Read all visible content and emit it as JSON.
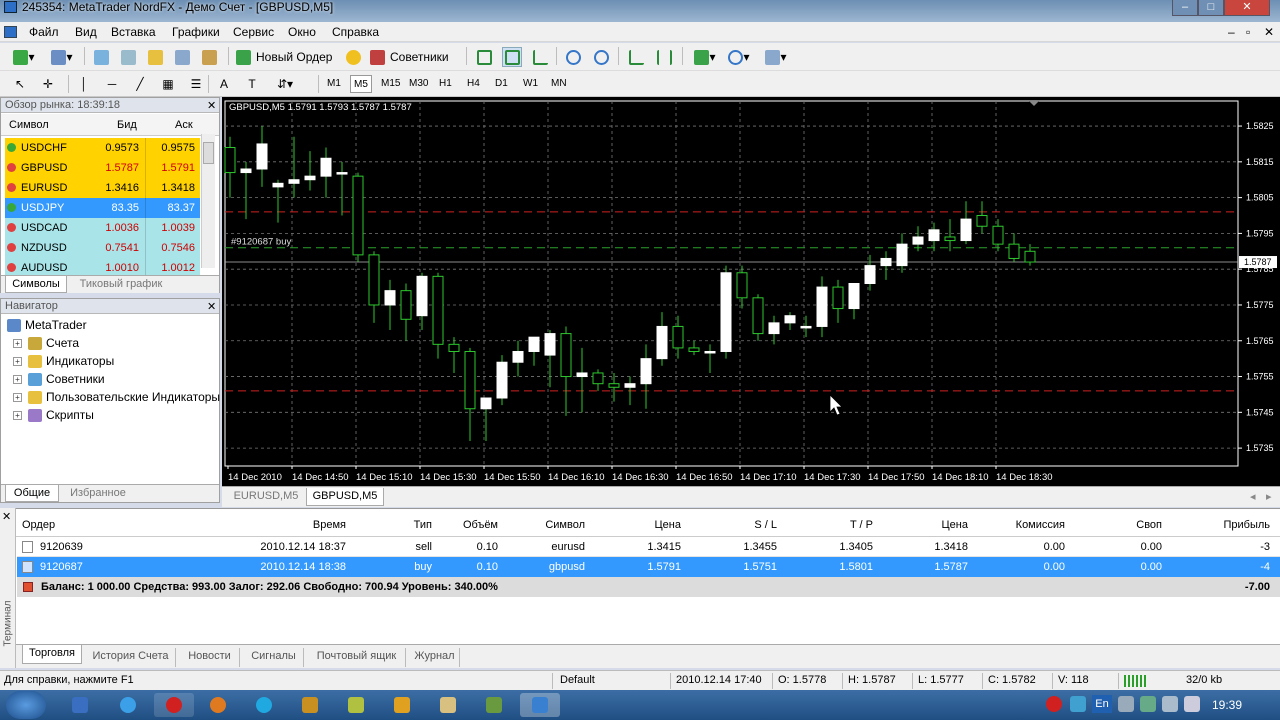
{
  "window": {
    "title": "245354: MetaTrader NordFX - Демо Счет - [GBPUSD,M5]"
  },
  "menu": [
    "Файл",
    "Вид",
    "Вставка",
    "Графики",
    "Сервис",
    "Окно",
    "Справка"
  ],
  "toolbar": {
    "new_order": "Новый Ордер",
    "experts": "Советники"
  },
  "timeframes": [
    "M1",
    "M5",
    "M15",
    "M30",
    "H1",
    "H4",
    "D1",
    "W1",
    "MN"
  ],
  "active_timeframe": "M5",
  "market_watch": {
    "title": "Обзор рынка: 18:39:18",
    "columns": {
      "symbol": "Символ",
      "bid": "Бид",
      "ask": "Аск"
    },
    "rows": [
      {
        "symbol": "USDCHF",
        "bid": "0.9573",
        "ask": "0.9575",
        "color": "#ffd200",
        "price_color": "#000000",
        "dir": "up"
      },
      {
        "symbol": "GBPUSD",
        "bid": "1.5787",
        "ask": "1.5791",
        "color": "#ffd200",
        "price_color": "#d00000",
        "dir": "down"
      },
      {
        "symbol": "EURUSD",
        "bid": "1.3416",
        "ask": "1.3418",
        "color": "#ffd200",
        "price_color": "#000000",
        "dir": "down"
      },
      {
        "symbol": "USDJPY",
        "bid": "83.35",
        "ask": "83.37",
        "color": "#3399ff",
        "price_color": "#ffffff",
        "dir": "up"
      },
      {
        "symbol": "USDCAD",
        "bid": "1.0036",
        "ask": "1.0039",
        "color": "#a8e4e8",
        "price_color": "#d00000",
        "dir": "down"
      },
      {
        "symbol": "NZDUSD",
        "bid": "0.7541",
        "ask": "0.7546",
        "color": "#a8e4e8",
        "price_color": "#d00000",
        "dir": "down"
      },
      {
        "symbol": "AUDUSD",
        "bid": "1.0010",
        "ask": "1.0012",
        "color": "#a8e4e8",
        "price_color": "#d00000",
        "dir": "down"
      }
    ],
    "tabs": [
      "Символы",
      "Тиковый график"
    ]
  },
  "navigator": {
    "title": "Навигатор",
    "root": "MetaTrader",
    "items": [
      "Счета",
      "Индикаторы",
      "Советники",
      "Пользовательские Индикаторы",
      "Скрипты"
    ],
    "tabs": [
      "Общие",
      "Избранное"
    ]
  },
  "chart": {
    "legend": "GBPUSD,M5  1.5791 1.5793 1.5787 1.5787",
    "order_label": "#9120687 buy",
    "current_price": "1.5787",
    "price_labels": [
      "1.5825",
      "1.5815",
      "1.5805",
      "1.5795",
      "1.5785",
      "1.5775",
      "1.5765",
      "1.5755",
      "1.5745",
      "1.5735"
    ],
    "time_labels": [
      "14 Dec 2010",
      "14 Dec 14:50",
      "14 Dec 15:10",
      "14 Dec 15:30",
      "14 Dec 15:50",
      "14 Dec 16:10",
      "14 Dec 16:30",
      "14 Dec 16:50",
      "14 Dec 17:10",
      "14 Dec 17:30",
      "14 Dec 17:50",
      "14 Dec 18:10",
      "14 Dec 18:30"
    ],
    "tabs": [
      "EURUSD,M5",
      "GBPUSD,M5"
    ],
    "lines": {
      "tp": 1.5801,
      "sl": 1.5751,
      "entry": 1.5791,
      "bid": 1.5787
    },
    "candles": [
      [
        1.5819,
        1.5822,
        1.5805,
        1.5812
      ],
      [
        1.5812,
        1.5815,
        1.5799,
        1.5813
      ],
      [
        1.5813,
        1.5825,
        1.5808,
        1.582
      ],
      [
        1.5808,
        1.581,
        1.5798,
        1.5809
      ],
      [
        1.5809,
        1.5822,
        1.5805,
        1.581
      ],
      [
        1.581,
        1.5818,
        1.5807,
        1.5811
      ],
      [
        1.5811,
        1.5819,
        1.5805,
        1.5816
      ],
      [
        1.5812,
        1.5815,
        1.58,
        1.5812
      ],
      [
        1.5811,
        1.5812,
        1.5787,
        1.5789
      ],
      [
        1.5789,
        1.579,
        1.577,
        1.5775
      ],
      [
        1.5775,
        1.5782,
        1.5768,
        1.5779
      ],
      [
        1.5779,
        1.5781,
        1.5765,
        1.5771
      ],
      [
        1.5772,
        1.5784,
        1.5768,
        1.5783
      ],
      [
        1.5783,
        1.5784,
        1.576,
        1.5764
      ],
      [
        1.5764,
        1.5766,
        1.5756,
        1.5762
      ],
      [
        1.5762,
        1.5763,
        1.5737,
        1.5746
      ],
      [
        1.5746,
        1.5749,
        1.5737,
        1.5749
      ],
      [
        1.5749,
        1.5761,
        1.5747,
        1.5759
      ],
      [
        1.5759,
        1.5765,
        1.5755,
        1.5762
      ],
      [
        1.5762,
        1.5765,
        1.5758,
        1.5766
      ],
      [
        1.5761,
        1.5768,
        1.5752,
        1.5767
      ],
      [
        1.5767,
        1.5769,
        1.5744,
        1.5755
      ],
      [
        1.5755,
        1.5763,
        1.5745,
        1.5756
      ],
      [
        1.5756,
        1.5757,
        1.5751,
        1.5753
      ],
      [
        1.5753,
        1.5756,
        1.5748,
        1.5752
      ],
      [
        1.5752,
        1.5755,
        1.5747,
        1.5753
      ],
      [
        1.5753,
        1.5764,
        1.5746,
        1.576
      ],
      [
        1.576,
        1.5773,
        1.5758,
        1.5769
      ],
      [
        1.5769,
        1.5772,
        1.576,
        1.5763
      ],
      [
        1.5763,
        1.5765,
        1.5761,
        1.5762
      ],
      [
        1.5762,
        1.5764,
        1.5756,
        1.5762
      ],
      [
        1.5762,
        1.5786,
        1.576,
        1.5784
      ],
      [
        1.5784,
        1.5786,
        1.5774,
        1.5777
      ],
      [
        1.5777,
        1.5778,
        1.5765,
        1.5767
      ],
      [
        1.5767,
        1.5772,
        1.5764,
        1.577
      ],
      [
        1.577,
        1.5773,
        1.5768,
        1.5772
      ],
      [
        1.5769,
        1.5772,
        1.5766,
        1.5769
      ],
      [
        1.5769,
        1.5783,
        1.5766,
        1.578
      ],
      [
        1.578,
        1.5782,
        1.577,
        1.5774
      ],
      [
        1.5774,
        1.5781,
        1.5771,
        1.5781
      ],
      [
        1.5781,
        1.5789,
        1.5779,
        1.5786
      ],
      [
        1.5786,
        1.579,
        1.5782,
        1.5788
      ],
      [
        1.5786,
        1.5795,
        1.5784,
        1.5792
      ],
      [
        1.5792,
        1.5797,
        1.579,
        1.5794
      ],
      [
        1.5793,
        1.5798,
        1.579,
        1.5796
      ],
      [
        1.5794,
        1.5799,
        1.579,
        1.5793
      ],
      [
        1.5793,
        1.5804,
        1.5792,
        1.5799
      ],
      [
        1.58,
        1.5804,
        1.5795,
        1.5797
      ],
      [
        1.5797,
        1.5799,
        1.579,
        1.5792
      ],
      [
        1.5792,
        1.5795,
        1.5787,
        1.5788
      ],
      [
        1.579,
        1.5792,
        1.5786,
        1.5787
      ]
    ],
    "chart_data": {
      "type": "table",
      "note": ""
    }
  },
  "terminal": {
    "side_label": "Терминал",
    "columns": [
      "Ордер",
      "Время",
      "Тип",
      "Объём",
      "Символ",
      "Цена",
      "S / L",
      "T / P",
      "Цена",
      "Комиссия",
      "Своп",
      "Прибыль"
    ],
    "rows": [
      [
        "9120639",
        "2010.12.14 18:37",
        "sell",
        "0.10",
        "eurusd",
        "1.3415",
        "1.3455",
        "1.3405",
        "1.3418",
        "0.00",
        "0.00",
        "-3"
      ],
      [
        "9120687",
        "2010.12.14 18:38",
        "buy",
        "0.10",
        "gbpusd",
        "1.5791",
        "1.5751",
        "1.5801",
        "1.5787",
        "0.00",
        "0.00",
        "-4"
      ]
    ],
    "balance": "Баланс: 1 000.00  Средства: 993.00  Залог: 292.06  Свободно: 700.94  Уровень: 340.00%",
    "total": "-7.00",
    "tabs": [
      "Торговля",
      "История Счета",
      "Новости",
      "Сигналы",
      "Почтовый ящик",
      "Журнал"
    ]
  },
  "statusbar": {
    "help": "Для справки, нажмите F1",
    "profile": "Default",
    "datetime": "2010.12.14 17:40",
    "open": "O: 1.5778",
    "high": "H: 1.5787",
    "low": "L: 1.5777",
    "close": "C: 1.5782",
    "volume": "V: 118",
    "traffic": "32/0 kb"
  },
  "taskbar": {
    "time": "19:39",
    "lang": "En"
  }
}
